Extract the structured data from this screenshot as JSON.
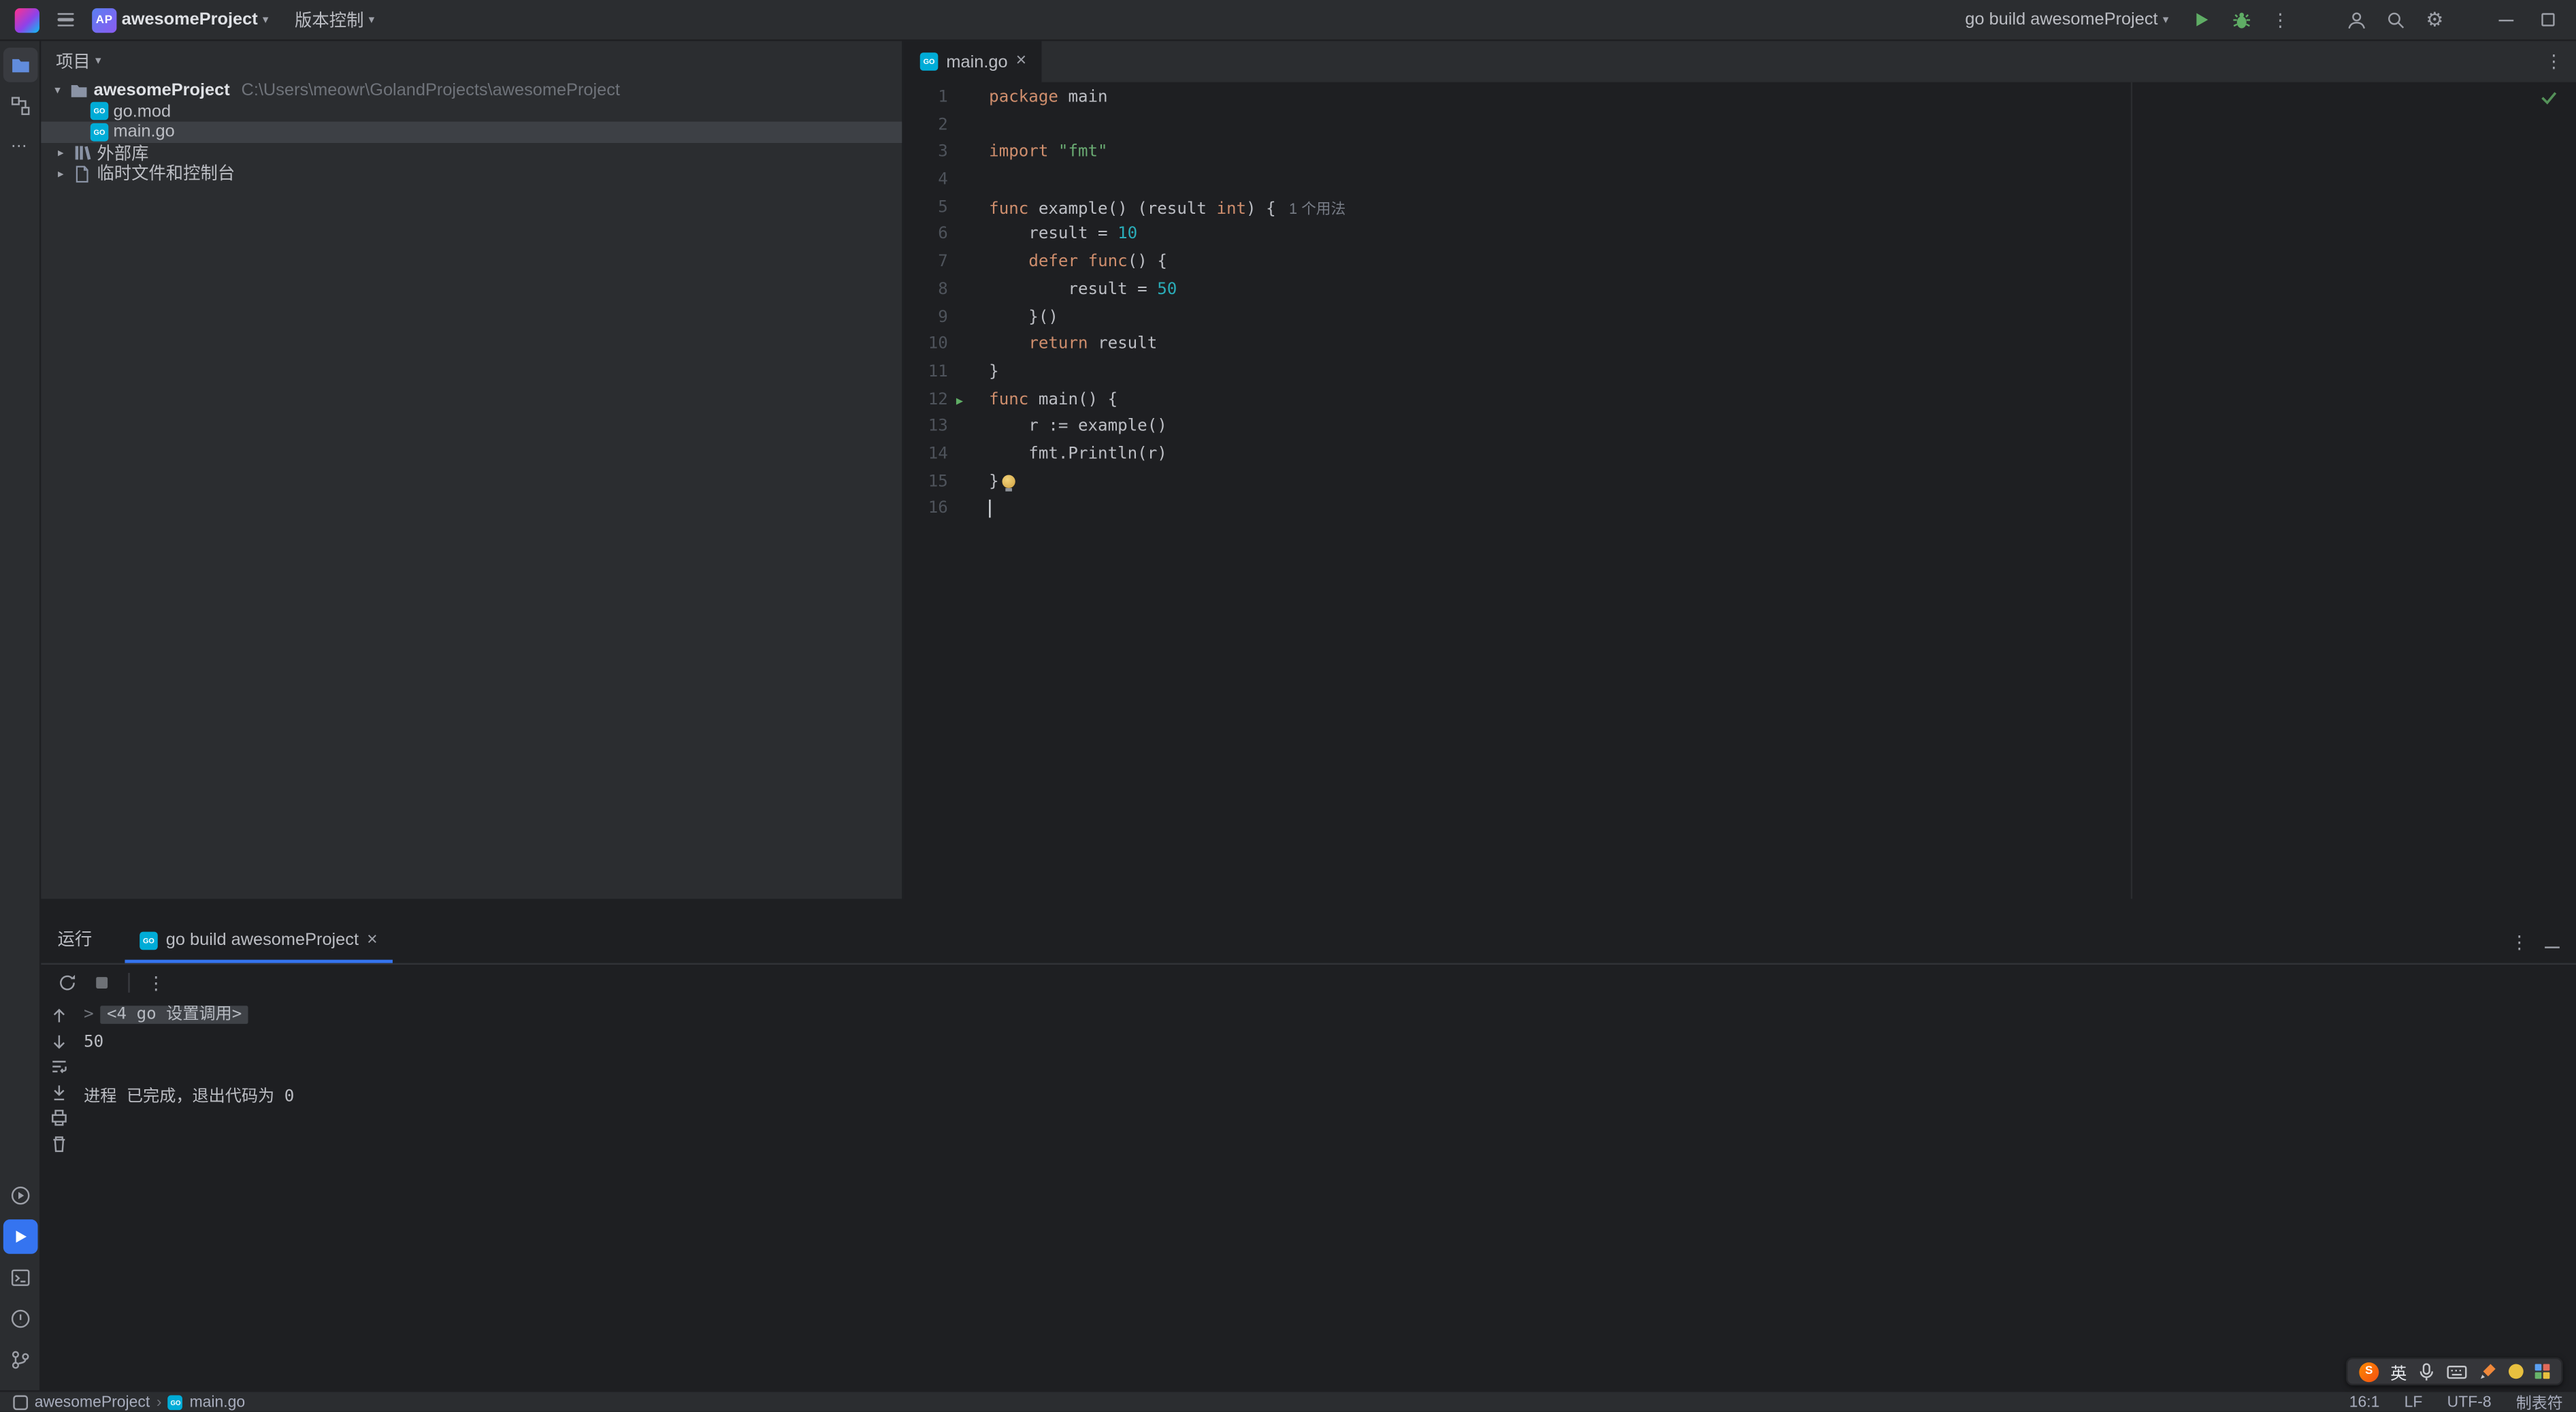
{
  "colors": {
    "accent": "#3574f0",
    "keyword": "#cf8e6d",
    "string": "#6aab73",
    "number": "#2aacb8",
    "run_green": "#5fad65",
    "editor_bg": "#1e1f22",
    "panel_bg": "#2b2d30"
  },
  "titlebar": {
    "badge": "AP",
    "project": "awesomeProject",
    "vcs": "版本控制",
    "run_config": "go build awesomeProject"
  },
  "project_panel": {
    "title": "项目",
    "root_name": "awesomeProject",
    "root_path": "C:\\Users\\meowr\\GolandProjects\\awesomeProject",
    "file1": "go.mod",
    "file2": "main.go",
    "node1": "外部库",
    "node2": "临时文件和控制台"
  },
  "editor": {
    "tab": "main.go",
    "lines": [
      {
        "n": "1",
        "t": [
          [
            "kw",
            "package"
          ],
          [
            "pl",
            " main"
          ]
        ]
      },
      {
        "n": "2",
        "t": []
      },
      {
        "n": "3",
        "t": [
          [
            "kw",
            "import"
          ],
          [
            "pl",
            " "
          ],
          [
            "str",
            "\"fmt\""
          ]
        ]
      },
      {
        "n": "4",
        "t": []
      },
      {
        "n": "5",
        "t": [
          [
            "kw",
            "func"
          ],
          [
            "pl",
            " example() (result "
          ],
          [
            "kw",
            "int"
          ],
          [
            "pl",
            ") {"
          ]
        ],
        "hint": "1 个用法"
      },
      {
        "n": "6",
        "t": [
          [
            "pl",
            "    result = "
          ],
          [
            "num",
            "10"
          ]
        ]
      },
      {
        "n": "7",
        "t": [
          [
            "pl",
            "    "
          ],
          [
            "kw",
            "defer"
          ],
          [
            "pl",
            " "
          ],
          [
            "kw",
            "func"
          ],
          [
            "pl",
            "() {"
          ]
        ]
      },
      {
        "n": "8",
        "t": [
          [
            "pl",
            "        result = "
          ],
          [
            "num",
            "50"
          ]
        ]
      },
      {
        "n": "9",
        "t": [
          [
            "pl",
            "    }()"
          ]
        ]
      },
      {
        "n": "10",
        "t": [
          [
            "pl",
            "    "
          ],
          [
            "kw",
            "return"
          ],
          [
            "pl",
            " result"
          ]
        ]
      },
      {
        "n": "11",
        "t": [
          [
            "pl",
            "}"
          ]
        ]
      },
      {
        "n": "12",
        "t": [
          [
            "kw",
            "func"
          ],
          [
            "pl",
            " main() {"
          ]
        ],
        "run": true
      },
      {
        "n": "13",
        "t": [
          [
            "pl",
            "    r := example()"
          ]
        ]
      },
      {
        "n": "14",
        "t": [
          [
            "pl",
            "    fmt.Println(r)"
          ]
        ]
      },
      {
        "n": "15",
        "t": [
          [
            "pl",
            "}"
          ]
        ],
        "bulb": true
      },
      {
        "n": "16",
        "t": [],
        "caret": true
      }
    ]
  },
  "run_panel": {
    "title": "运行",
    "tab": "go build awesomeProject",
    "console": [
      {
        "chip": "<4 go 设置调用>"
      },
      {
        "text": "50"
      },
      {
        "text": ""
      },
      {
        "text": "进程 已完成，退出代码为 0"
      }
    ]
  },
  "statusbar": {
    "crumb1": "awesomeProject",
    "crumb2": "main.go",
    "position": "16:1",
    "line_sep": "LF",
    "encoding": "UTF-8",
    "indent": "制表符"
  },
  "ime": {
    "logo": "S",
    "lang": "英"
  }
}
